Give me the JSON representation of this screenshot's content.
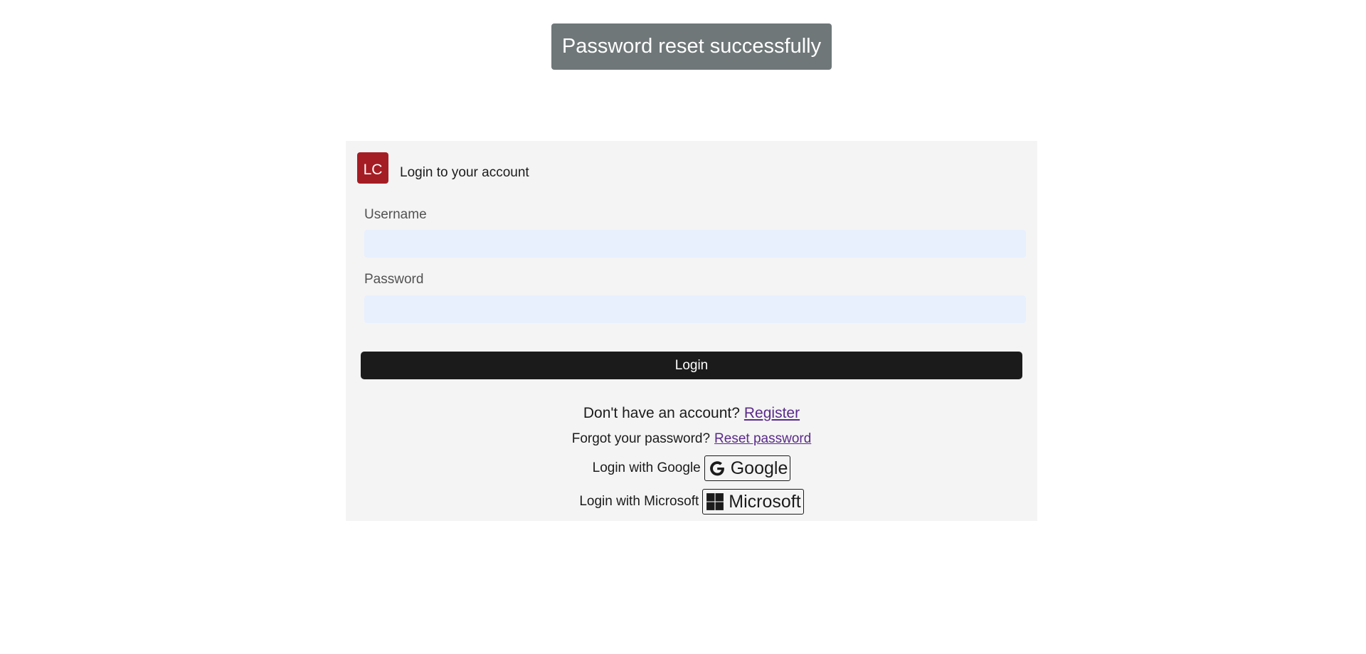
{
  "toast": {
    "message": "Password reset successfully"
  },
  "card": {
    "logo_text": "LC",
    "heading": "Login to your account",
    "username": {
      "label": "Username",
      "value": ""
    },
    "password": {
      "label": "Password",
      "value": ""
    },
    "login_button": "Login",
    "register_prompt": "Don't have an account?",
    "register_link": "Register",
    "forgot_prompt": "Forgot your password?",
    "reset_link": "Reset password",
    "google_prompt": "Login with Google",
    "google_button": "Google",
    "google_icon": "google-g-icon",
    "microsoft_prompt": "Login with Microsoft",
    "microsoft_button": "Microsoft",
    "microsoft_icon": "windows-logo-icon"
  },
  "colors": {
    "toast_bg": "#6f7778",
    "card_bg": "#f4f4f4",
    "logo_bg": "#a51d24",
    "input_bg": "#e8f0fe",
    "button_bg": "#1b1b1b",
    "link": "#5a2a8a"
  }
}
